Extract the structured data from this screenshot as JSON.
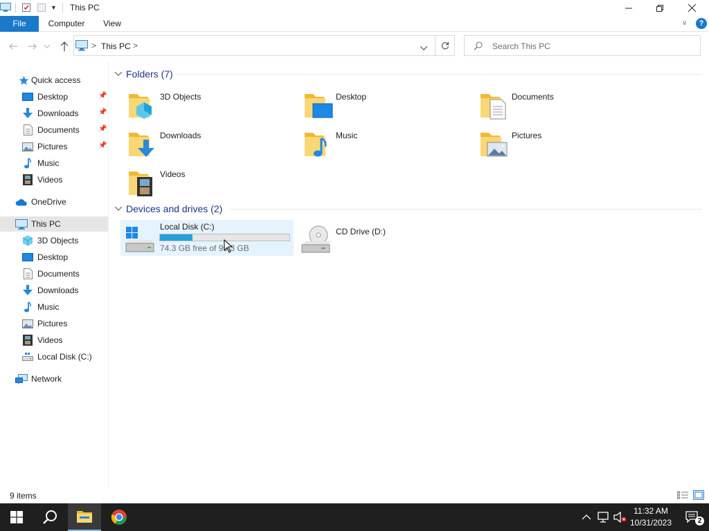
{
  "window": {
    "title": "This PC"
  },
  "ribbon": {
    "tabs": [
      {
        "label": "File"
      },
      {
        "label": "Computer"
      },
      {
        "label": "View"
      }
    ],
    "help_label": "?"
  },
  "address": {
    "crumbs": [
      ">",
      "This PC",
      ">"
    ],
    "search_placeholder": "Search This PC"
  },
  "sidebar": {
    "quick_access": {
      "label": "Quick access",
      "items": [
        {
          "label": "Desktop",
          "icon": "desktop-icon",
          "pinned": true
        },
        {
          "label": "Downloads",
          "icon": "downloads-icon",
          "pinned": true
        },
        {
          "label": "Documents",
          "icon": "documents-icon",
          "pinned": true
        },
        {
          "label": "Pictures",
          "icon": "pictures-icon",
          "pinned": true
        },
        {
          "label": "Music",
          "icon": "music-icon",
          "pinned": false
        },
        {
          "label": "Videos",
          "icon": "videos-icon",
          "pinned": false
        }
      ]
    },
    "onedrive": {
      "label": "OneDrive"
    },
    "this_pc": {
      "label": "This PC",
      "items": [
        {
          "label": "3D Objects",
          "icon": "3d-objects-icon"
        },
        {
          "label": "Desktop",
          "icon": "desktop-icon"
        },
        {
          "label": "Documents",
          "icon": "documents-icon"
        },
        {
          "label": "Downloads",
          "icon": "downloads-icon"
        },
        {
          "label": "Music",
          "icon": "music-icon"
        },
        {
          "label": "Pictures",
          "icon": "pictures-icon"
        },
        {
          "label": "Videos",
          "icon": "videos-icon"
        },
        {
          "label": "Local Disk (C:)",
          "icon": "local-disk-icon"
        }
      ]
    },
    "network": {
      "label": "Network"
    }
  },
  "content": {
    "folders_header": "Folders (7)",
    "folders": [
      {
        "label": "3D Objects",
        "icon": "3d-objects-folder-icon"
      },
      {
        "label": "Desktop",
        "icon": "desktop-folder-icon"
      },
      {
        "label": "Documents",
        "icon": "documents-folder-icon"
      },
      {
        "label": "Downloads",
        "icon": "downloads-folder-icon"
      },
      {
        "label": "Music",
        "icon": "music-folder-icon"
      },
      {
        "label": "Pictures",
        "icon": "pictures-folder-icon"
      },
      {
        "label": "Videos",
        "icon": "videos-folder-icon"
      }
    ],
    "drives_header": "Devices and drives (2)",
    "drives": [
      {
        "label": "Local Disk (C:)",
        "subtitle": "74.3 GB free of 99.3 GB",
        "used_fraction": 0.25,
        "icon": "windows-drive-icon"
      },
      {
        "label": "CD Drive (D:)",
        "icon": "cd-drive-icon"
      }
    ]
  },
  "status": {
    "item_count": "9 items"
  },
  "taskbar": {
    "time": "11:32 AM",
    "date": "10/31/2023",
    "notification_count": "2"
  },
  "colors": {
    "accent": "#1979ca",
    "header_text": "#1e3287",
    "folder_yellow": "#f4c54a",
    "drive_bar": "#26a0da",
    "taskbar": "#1f1f1f"
  }
}
